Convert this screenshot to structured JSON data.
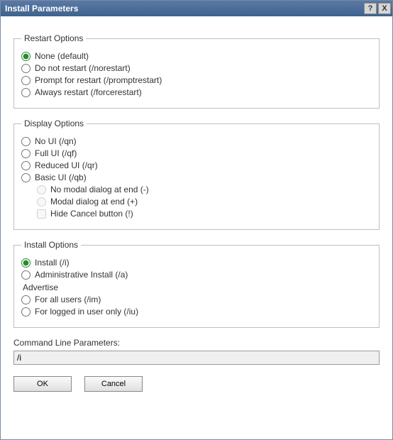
{
  "window": {
    "title": "Install Parameters",
    "help_symbol": "?",
    "close_symbol": "X"
  },
  "restart": {
    "legend": "Restart Options",
    "options": {
      "none": "None (default)",
      "norestart": "Do not restart (/norestart)",
      "prompt": "Prompt for restart (/promptrestart)",
      "force": "Always restart (/forcerestart)"
    },
    "selected": "none"
  },
  "display": {
    "legend": "Display Options",
    "options": {
      "noui": "No UI (/qn)",
      "fullui": "Full UI (/qf)",
      "reducedui": "Reduced UI (/qr)",
      "basicui": "Basic UI (/qb)"
    },
    "basic_sub": {
      "no_modal": "No modal dialog at end (-)",
      "modal": "Modal dialog at end (+)",
      "hide_cancel": "Hide Cancel button (!)"
    }
  },
  "install": {
    "legend": "Install Options",
    "options": {
      "install": "Install (/i)",
      "admin": "Administrative Install (/a)"
    },
    "selected": "install",
    "advertise_label": "Advertise",
    "advertise": {
      "all": "For all users (/im)",
      "user": "For logged in user only (/iu)"
    }
  },
  "command_line": {
    "label": "Command Line Parameters:",
    "value": "/i"
  },
  "buttons": {
    "ok": "OK",
    "cancel": "Cancel"
  }
}
